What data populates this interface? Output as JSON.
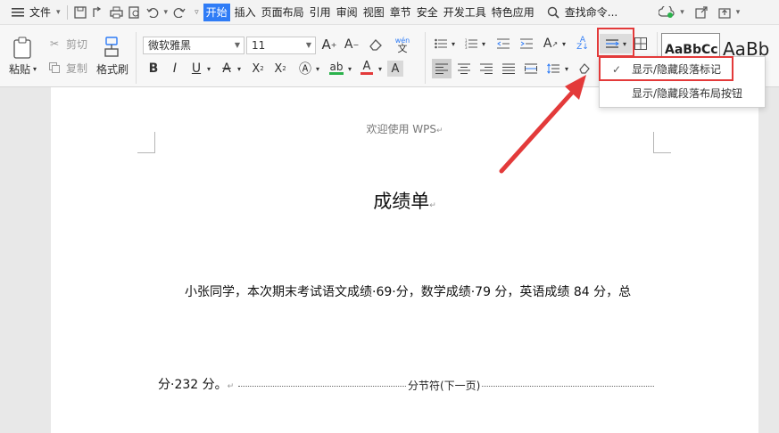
{
  "menubar": {
    "file": "文件",
    "tabs": [
      "开始",
      "插入",
      "页面布局",
      "引用",
      "审阅",
      "视图",
      "章节",
      "安全",
      "开发工具",
      "特色应用"
    ],
    "search": "查找命令..."
  },
  "ribbon": {
    "paste": "粘贴",
    "cut": "剪切",
    "copy": "复制",
    "format_painter": "格式刷",
    "font_name": "微软雅黑",
    "font_size": "11",
    "style_preview_1": "AaBbCc",
    "style_preview_2": "AaBb"
  },
  "dropdown": {
    "show_hide_marks": "显示/隐藏段落标记",
    "show_hide_layout": "显示/隐藏段落布局按钮"
  },
  "document": {
    "header": "欢迎使用 WPS",
    "title": "成绩单",
    "para1": "小张同学，本次期末考试语文成绩·69·分，数学成绩·79 分，英语成绩 84 分，总",
    "para2": "分·232 分。",
    "section_break": "分节符(下一页)"
  },
  "colors": {
    "accent": "#2f7cf6",
    "highlight": "#e33a3a",
    "page": "#ffffff"
  }
}
